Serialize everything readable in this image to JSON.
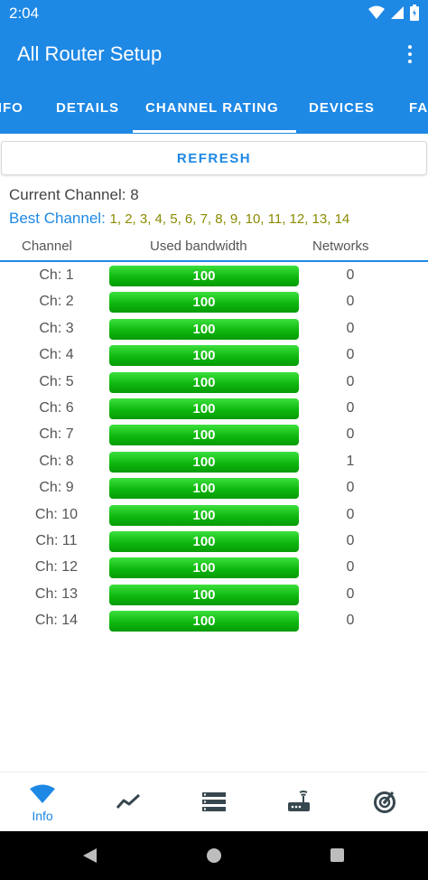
{
  "status_bar": {
    "time": "2:04"
  },
  "app": {
    "title": "All Router Setup"
  },
  "tabs": [
    {
      "label": "INFO"
    },
    {
      "label": "DETAILS"
    },
    {
      "label": "CHANNEL RATING"
    },
    {
      "label": "DEVICES"
    },
    {
      "label": "FA"
    }
  ],
  "refresh_label": "REFRESH",
  "current_channel": {
    "label": "Current Channel: ",
    "value": "8"
  },
  "best_channel": {
    "label": "Best Channel: ",
    "value": "1, 2, 3, 4, 5, 6, 7, 8, 9, 10, 11, 12, 13, 14"
  },
  "columns": {
    "channel": "Channel",
    "bandwidth": "Used bandwidth",
    "networks": "Networks"
  },
  "rows": [
    {
      "channel": "Ch: 1",
      "bandwidth": "100",
      "networks": "0"
    },
    {
      "channel": "Ch: 2",
      "bandwidth": "100",
      "networks": "0"
    },
    {
      "channel": "Ch: 3",
      "bandwidth": "100",
      "networks": "0"
    },
    {
      "channel": "Ch: 4",
      "bandwidth": "100",
      "networks": "0"
    },
    {
      "channel": "Ch: 5",
      "bandwidth": "100",
      "networks": "0"
    },
    {
      "channel": "Ch: 6",
      "bandwidth": "100",
      "networks": "0"
    },
    {
      "channel": "Ch: 7",
      "bandwidth": "100",
      "networks": "0"
    },
    {
      "channel": "Ch: 8",
      "bandwidth": "100",
      "networks": "1"
    },
    {
      "channel": "Ch: 9",
      "bandwidth": "100",
      "networks": "0"
    },
    {
      "channel": "Ch: 10",
      "bandwidth": "100",
      "networks": "0"
    },
    {
      "channel": "Ch: 11",
      "bandwidth": "100",
      "networks": "0"
    },
    {
      "channel": "Ch: 12",
      "bandwidth": "100",
      "networks": "0"
    },
    {
      "channel": "Ch: 13",
      "bandwidth": "100",
      "networks": "0"
    },
    {
      "channel": "Ch: 14",
      "bandwidth": "100",
      "networks": "0"
    }
  ],
  "bottom_nav": [
    {
      "icon": "wifi-icon",
      "label": "Info",
      "active": true
    },
    {
      "icon": "chart-line-icon",
      "label": ""
    },
    {
      "icon": "list-icon",
      "label": ""
    },
    {
      "icon": "router-icon",
      "label": ""
    },
    {
      "icon": "radar-icon",
      "label": ""
    }
  ],
  "colors": {
    "primary": "#1e88e5",
    "bar_green": "#0eb80e",
    "best_values": "#8a8a00"
  }
}
